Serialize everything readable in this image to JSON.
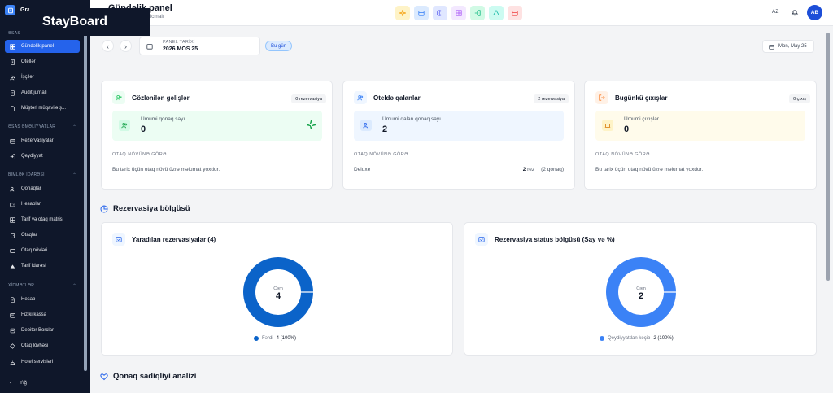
{
  "sidebar": {
    "brand": "Granc",
    "sections": [
      {
        "label": "ƏSAS"
      },
      {
        "label": "ƏSAS ƏMƏLİYYATLAR"
      },
      {
        "label": "BİMLƏK İDARƏSİ"
      },
      {
        "label": "XİDMƏTLƏR"
      }
    ],
    "items": [
      {
        "label": "Gündəlik panel",
        "icon": "dashboard-icon"
      },
      {
        "label": "Otellər",
        "icon": "building-icon"
      },
      {
        "label": "İşçilər",
        "icon": "users-icon"
      },
      {
        "label": "Audit jurnalı",
        "icon": "audit-icon"
      },
      {
        "label": "Müştəri müqavilə ş...",
        "icon": "document-icon"
      },
      {
        "label": "Rezervasiyalar",
        "icon": "calendar-icon"
      },
      {
        "label": "Qeydiyyat",
        "icon": "login-icon"
      },
      {
        "label": "Qonaqlar",
        "icon": "users-icon"
      },
      {
        "label": "Hesablar",
        "icon": "wallet-icon"
      },
      {
        "label": "Tarif və otaq matrisi",
        "icon": "grid-icon"
      },
      {
        "label": "Otaqlar",
        "icon": "door-icon"
      },
      {
        "label": "Otaq növləri",
        "icon": "layers-icon"
      },
      {
        "label": "Tarif idarəsi",
        "icon": "tag-icon"
      },
      {
        "label": "Hesab",
        "icon": "file-icon"
      },
      {
        "label": "Fiziki kassa",
        "icon": "cash-icon"
      },
      {
        "label": "Debitor Borclar",
        "icon": "debt-icon"
      },
      {
        "label": "Otaq lövhəsi",
        "icon": "board-icon"
      },
      {
        "label": "Hotel servisləri",
        "icon": "service-icon"
      }
    ],
    "collapse_label": "Yığ"
  },
  "overlay_brand": "StayBoard",
  "header": {
    "title": "Gündəlik panel",
    "subtitle": "...anının real vaxt icmalı",
    "language": "AZ",
    "avatar": "AB",
    "quick_icons": [
      {
        "icon": "sparkle-icon",
        "color": "#f59e0b",
        "bg": "#fef3c7"
      },
      {
        "icon": "calendar-icon",
        "color": "#3b82f6",
        "bg": "#dbeafe"
      },
      {
        "icon": "moon-icon",
        "color": "#6366f1",
        "bg": "#e0e7ff"
      },
      {
        "icon": "grid-icon",
        "color": "#a855f7",
        "bg": "#f3e8ff"
      },
      {
        "icon": "login-icon",
        "color": "#10b981",
        "bg": "#d1fae5"
      },
      {
        "icon": "triangle-icon",
        "color": "#14b8a6",
        "bg": "#ccfbf1"
      },
      {
        "icon": "calendar-x-icon",
        "color": "#ef4444",
        "bg": "#fee2e2"
      }
    ]
  },
  "toolbar": {
    "date_label": "PANEL TARİXİ",
    "date_value": "2026 MOS 25",
    "today_label": "Bu gün",
    "date_pill": "Mon, May 25"
  },
  "cards": [
    {
      "title": "Gözlənilən gəlişlər",
      "badge": "0 rezervasiya",
      "metric_label": "Ümumi qonaq sayı",
      "metric_value": "0",
      "group_label": "OTAQ NÖVÜNƏ GÖRƏ",
      "note": "Bu tarix üçün otaq növü üzrə məlumat yoxdur.",
      "accent": "#22c55e",
      "metric_bg": "#ecfdf3"
    },
    {
      "title": "Oteldə qalanlar",
      "badge": "2 rezervasiya",
      "metric_label": "Ümumi qalan qonaq sayı",
      "metric_value": "2",
      "group_label": "OTAQ NÖVÜNƏ GÖRƏ",
      "row_type": "Deluxe",
      "row_count": "2",
      "row_unit": "rez",
      "row_guests": "(2 qonaq)",
      "accent": "#3b82f6",
      "metric_bg": "#eff6ff"
    },
    {
      "title": "Bugünkü çıxışlar",
      "badge": "0 çıxış",
      "metric_label": "Ümumi çıxışlar",
      "metric_value": "0",
      "group_label": "OTAQ NÖVÜNƏ GÖRƏ",
      "note": "Bu tarix üçün otaq növü üzrə məlumat yoxdur.",
      "accent": "#f97316",
      "metric_bg": "#fffbeb"
    }
  ],
  "sections": {
    "reservation": "Rezervasiya bölgüsü",
    "loyalty": "Qonaq sadiqliyi analizi"
  },
  "chart_data": [
    {
      "type": "pie",
      "title": "Yaradılan rezervasiyalar (4)",
      "center_label": "Cəm",
      "center_value": "4",
      "categories": [
        "Fərdi"
      ],
      "values": [
        4
      ],
      "value_labels": [
        "4 (100%)"
      ],
      "colors": [
        "#0b63c9"
      ]
    },
    {
      "type": "pie",
      "title": "Rezervasiya status bölgüsü (Say və %)",
      "center_label": "Cəm",
      "center_value": "2",
      "categories": [
        "Qeydiyyatdan keçib"
      ],
      "values": [
        2
      ],
      "value_labels": [
        "2 (100%)"
      ],
      "colors": [
        "#3b82f6"
      ]
    }
  ]
}
